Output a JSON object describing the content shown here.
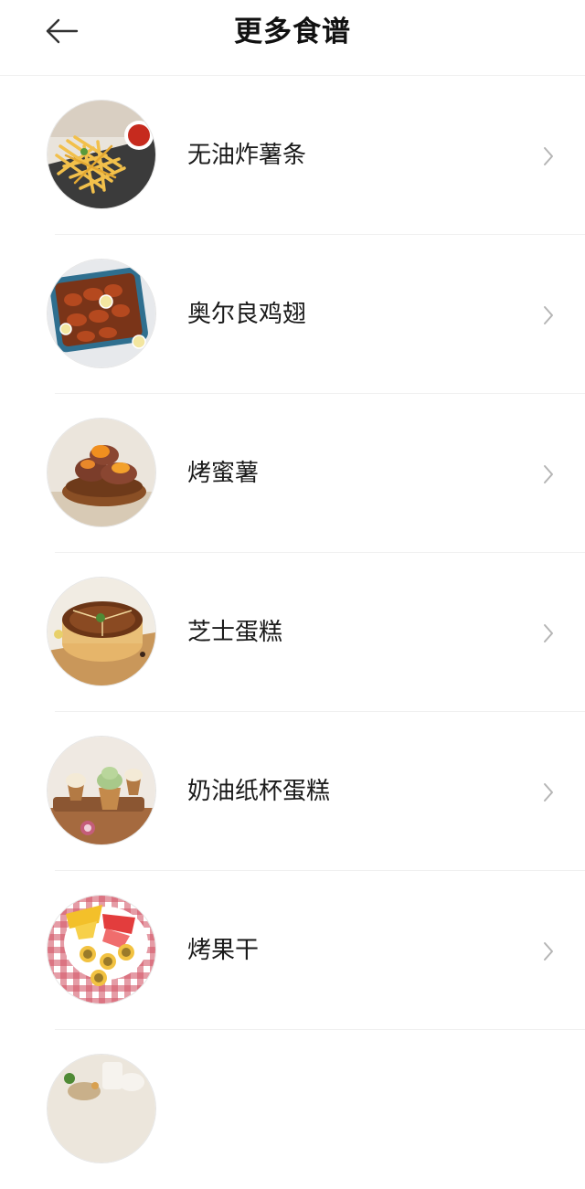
{
  "header": {
    "title": "更多食谱",
    "back_icon": "arrow-left-icon"
  },
  "recipes": [
    {
      "label": "无油炸薯条",
      "image": "fries-image"
    },
    {
      "label": "奥尔良鸡翅",
      "image": "chicken-wings-image"
    },
    {
      "label": "烤蜜薯",
      "image": "sweet-potato-image"
    },
    {
      "label": "芝士蛋糕",
      "image": "cheesecake-image"
    },
    {
      "label": "奶油纸杯蛋糕",
      "image": "cupcake-image"
    },
    {
      "label": "烤果干",
      "image": "dried-fruit-image"
    },
    {
      "label": "",
      "image": "partial-recipe-image"
    }
  ],
  "icons": {
    "chevron": "chevron-right-icon"
  },
  "colors": {
    "background": "#ffffff",
    "divider": "#f0f0f0",
    "chevron": "#b5b5b5"
  }
}
